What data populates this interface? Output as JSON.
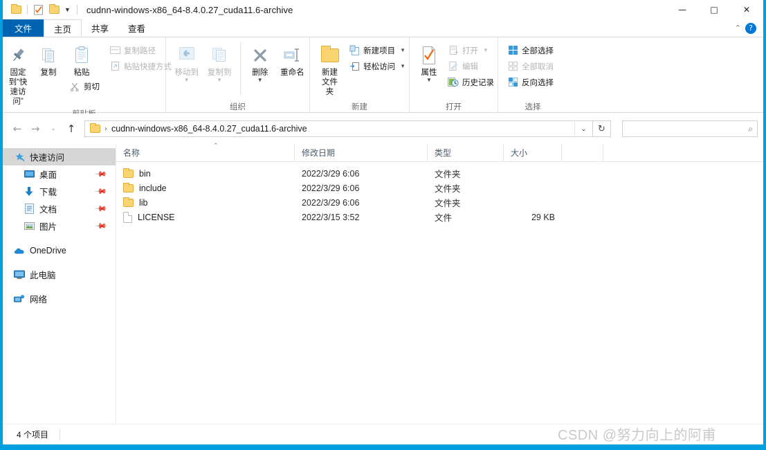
{
  "window": {
    "title": "cudnn-windows-x86_64-8.4.0.27_cuda11.6-archive",
    "accent_color": "#00a0e0",
    "file_tab_color": "#0063b1",
    "quick_access": [
      {
        "name": "folder-icon",
        "label": ""
      },
      {
        "name": "properties-icon",
        "label": ""
      },
      {
        "name": "new-folder-icon",
        "label": ""
      },
      {
        "name": "qat-dropdown-caret",
        "label": "▾"
      }
    ],
    "controls": {
      "minimize": "—",
      "maximize": "□",
      "close": "✕"
    },
    "ribbon_collapse": "⌃",
    "help": "?"
  },
  "tabs": [
    {
      "label": "文件",
      "kind": "file"
    },
    {
      "label": "主页",
      "kind": "active"
    },
    {
      "label": "共享",
      "kind": "normal"
    },
    {
      "label": "查看",
      "kind": "normal"
    }
  ],
  "ribbon": {
    "groups": [
      {
        "label": "剪贴板",
        "big": [
          {
            "label": "固定到“快\n速访问”",
            "icon": "pin-icon",
            "dim": false
          },
          {
            "label": "复制",
            "icon": "copy-icon",
            "dim": false
          },
          {
            "label": "粘贴",
            "icon": "paste-icon",
            "dim": false,
            "caret": true
          }
        ],
        "small": [
          {
            "label": "复制路径",
            "icon": "copy-path-icon",
            "dim": true
          },
          {
            "label": "粘贴快捷方式",
            "icon": "paste-shortcut-icon",
            "dim": true
          }
        ],
        "small_under_paste": [
          {
            "label": "剪切",
            "icon": "scissors-icon",
            "dim": false
          }
        ]
      },
      {
        "label": "组织",
        "big": [
          {
            "label": "移动到",
            "icon": "move-to-icon",
            "dim": true,
            "caret": true
          },
          {
            "label": "复制到",
            "icon": "copy-to-icon",
            "dim": true,
            "caret": true
          },
          {
            "label": "删除",
            "icon": "delete-x-icon",
            "dim": false,
            "caret": true
          },
          {
            "label": "重命名",
            "icon": "rename-icon",
            "dim": false
          }
        ]
      },
      {
        "label": "新建",
        "big": [
          {
            "label": "新建\n文件夹",
            "icon": "new-folder-icon",
            "dim": false
          }
        ],
        "small": [
          {
            "label": "新建项目",
            "icon": "new-item-icon",
            "dim": false,
            "caret": "▾"
          },
          {
            "label": "轻松访问",
            "icon": "easy-access-icon",
            "dim": false,
            "caret": "▾"
          }
        ]
      },
      {
        "label": "打开",
        "big": [
          {
            "label": "属性",
            "icon": "properties-icon",
            "dim": false,
            "caret": true
          }
        ],
        "small": [
          {
            "label": "打开",
            "icon": "open-icon",
            "dim": true,
            "caret": "▾"
          },
          {
            "label": "编辑",
            "icon": "edit-icon",
            "dim": true
          },
          {
            "label": "历史记录",
            "icon": "history-icon",
            "dim": false
          }
        ]
      },
      {
        "label": "选择",
        "small": [
          {
            "label": "全部选择",
            "icon": "select-all-icon",
            "dim": false
          },
          {
            "label": "全部取消",
            "icon": "select-none-icon",
            "dim": true
          },
          {
            "label": "反向选择",
            "icon": "invert-selection-icon",
            "dim": false
          }
        ]
      }
    ]
  },
  "navigation": {
    "back": "←",
    "forward": "→",
    "recent": "⌄",
    "up": "↑",
    "breadcrumb_icon": "folder-icon",
    "breadcrumb_separator": "›",
    "breadcrumb": "cudnn-windows-x86_64-8.4.0.27_cuda11.6-archive",
    "address_caret": "⌄",
    "refresh": "↻",
    "search_value": "",
    "search_placeholder": "",
    "search_icon": "⌕"
  },
  "sidebar": {
    "items": [
      {
        "label": "快速访问",
        "icon": "quick-access-star-icon",
        "level": "root",
        "selected": true,
        "pinned": false
      },
      {
        "label": "桌面",
        "icon": "desktop-icon",
        "level": "child",
        "selected": false,
        "pinned": true
      },
      {
        "label": "下载",
        "icon": "downloads-icon",
        "level": "child",
        "selected": false,
        "pinned": true
      },
      {
        "label": "文档",
        "icon": "documents-icon",
        "level": "child",
        "selected": false,
        "pinned": true
      },
      {
        "label": "图片",
        "icon": "pictures-icon",
        "level": "child",
        "selected": false,
        "pinned": true
      },
      {
        "label": "OneDrive",
        "icon": "onedrive-cloud-icon",
        "level": "root",
        "selected": false,
        "pinned": false,
        "gap_before": true
      },
      {
        "label": "此电脑",
        "icon": "this-pc-icon",
        "level": "root",
        "selected": false,
        "pinned": false,
        "gap_before": true
      },
      {
        "label": "网络",
        "icon": "network-icon",
        "level": "root",
        "selected": false,
        "pinned": false,
        "gap_before": true
      }
    ]
  },
  "filelist": {
    "columns": [
      {
        "key": "name",
        "label": "名称"
      },
      {
        "key": "date",
        "label": "修改日期"
      },
      {
        "key": "type",
        "label": "类型"
      },
      {
        "key": "size",
        "label": "大小"
      }
    ],
    "sort_indicator": "⌃",
    "rows": [
      {
        "name": "bin",
        "date": "2022/3/29 6:06",
        "type": "文件夹",
        "size": "",
        "icon": "folder-icon"
      },
      {
        "name": "include",
        "date": "2022/3/29 6:06",
        "type": "文件夹",
        "size": "",
        "icon": "folder-icon"
      },
      {
        "name": "lib",
        "date": "2022/3/29 6:06",
        "type": "文件夹",
        "size": "",
        "icon": "folder-icon"
      },
      {
        "name": "LICENSE",
        "date": "2022/3/15 3:52",
        "type": "文件",
        "size": "29 KB",
        "icon": "file-icon"
      }
    ]
  },
  "statusbar": {
    "item_count": "4 个项目"
  },
  "watermark": {
    "text": "CSDN @努力向上的阿甫"
  }
}
